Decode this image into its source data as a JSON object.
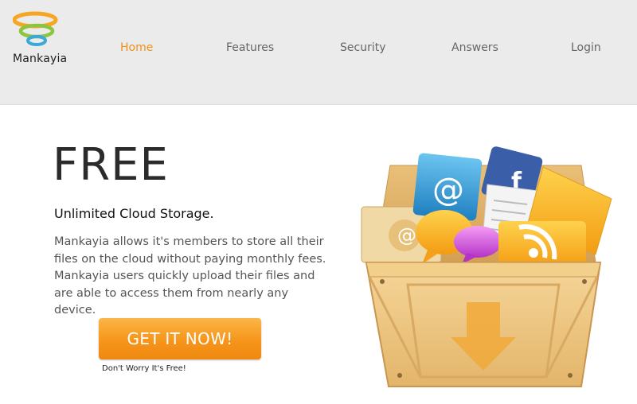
{
  "brand": {
    "name": "Mankayia",
    "colors": {
      "orange": "#F5A623",
      "green": "#7DC242",
      "blue": "#3AA8D8"
    }
  },
  "nav": {
    "items": [
      {
        "label": "Home",
        "active": true
      },
      {
        "label": "Features",
        "active": false
      },
      {
        "label": "Security",
        "active": false
      },
      {
        "label": "Answers",
        "active": false
      },
      {
        "label": "Login",
        "active": false
      }
    ],
    "active_color": "#F0921A"
  },
  "hero": {
    "title": "FREE",
    "subtitle": "Unlimited Cloud Storage.",
    "description": "Mankayia allows it's members to store all their files on the cloud without paying monthly fees. Mankayia users quickly upload their files and are able to access them from nearly any device.",
    "cta_label": "GET IT NOW!",
    "cta_note": "Don't Worry It's Free!"
  },
  "illustration": {
    "subject": "wooden crate full of app icons",
    "icons": [
      "email-icon",
      "facebook-icon",
      "document-icon",
      "folder-icon",
      "chat-bubble-icon",
      "rss-icon",
      "download-arrow-icon"
    ]
  }
}
